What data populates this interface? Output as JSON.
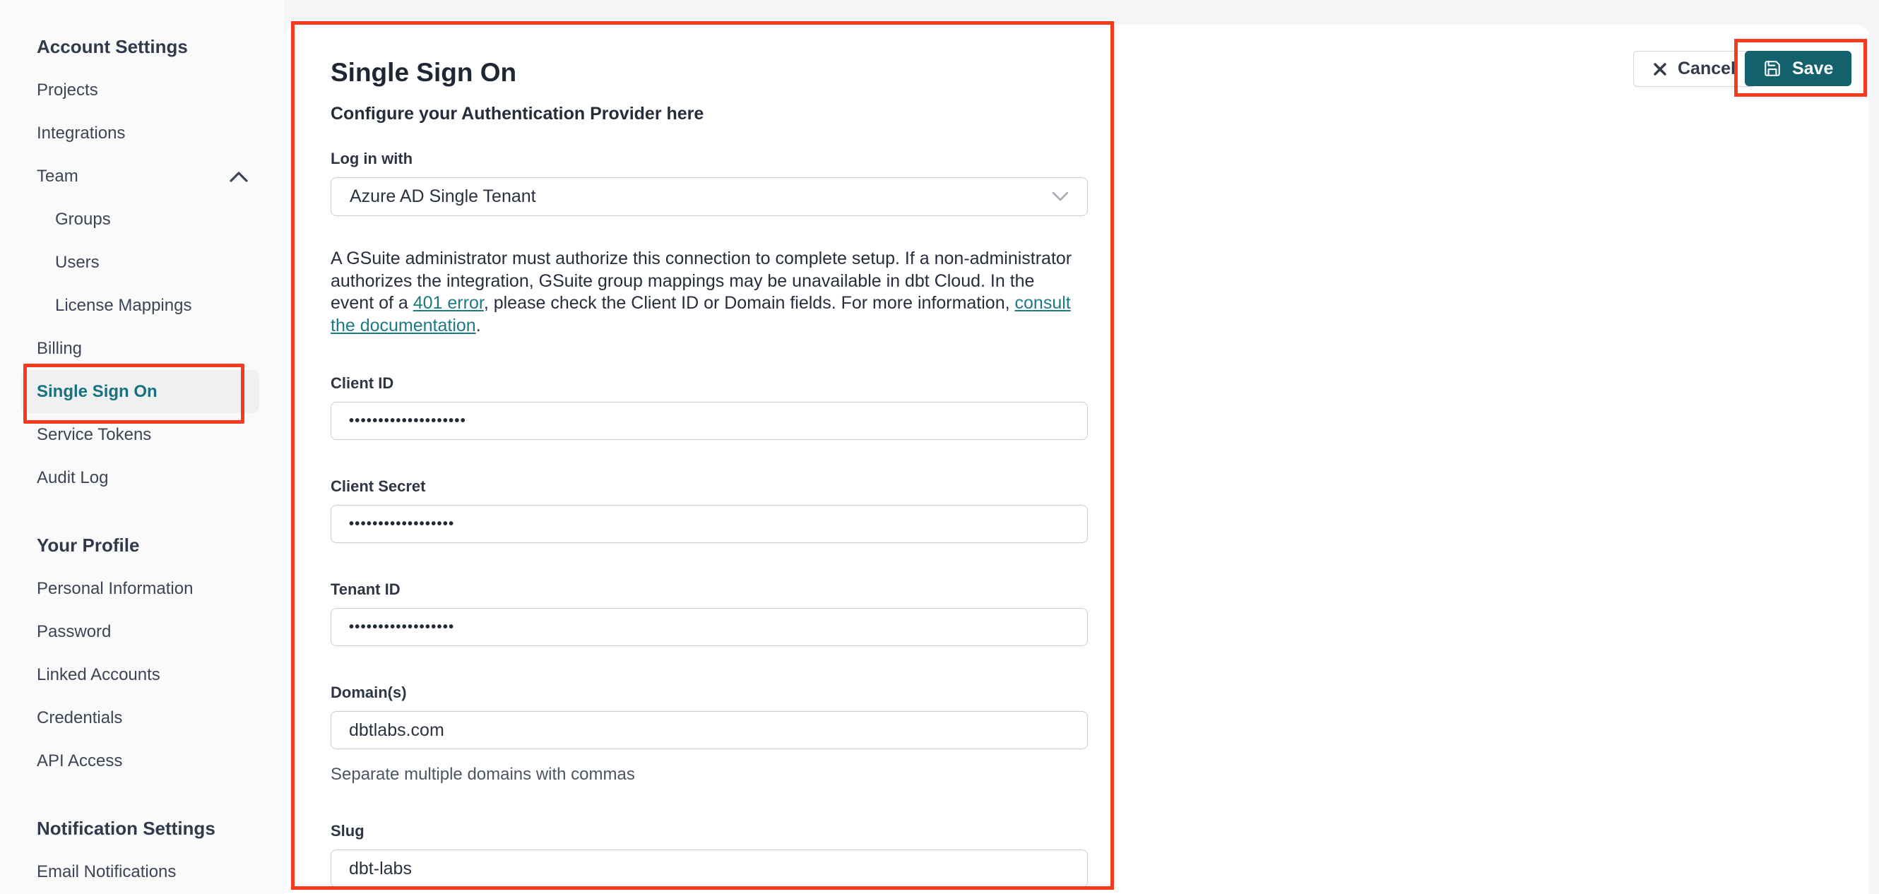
{
  "colors": {
    "accent_teal": "#18717f",
    "link_teal": "#1e7987",
    "save_button_bg": "#12616d",
    "annotation_red": "#f53b1e"
  },
  "sidebar": {
    "items": [
      {
        "label": "Account Settings"
      },
      {
        "label": "Projects"
      },
      {
        "label": "Integrations"
      },
      {
        "label": "Team"
      },
      {
        "label": "Groups"
      },
      {
        "label": "Users"
      },
      {
        "label": "License Mappings"
      },
      {
        "label": "Billing"
      },
      {
        "label": "Single Sign On"
      },
      {
        "label": "Service Tokens"
      },
      {
        "label": "Audit Log"
      },
      {
        "label": "Your Profile"
      },
      {
        "label": "Personal Information"
      },
      {
        "label": "Password"
      },
      {
        "label": "Linked Accounts"
      },
      {
        "label": "Credentials"
      },
      {
        "label": "API Access"
      },
      {
        "label": "Notification Settings"
      },
      {
        "label": "Email Notifications"
      }
    ]
  },
  "header_actions": {
    "cancel_label": "Cancel",
    "save_label": "Save"
  },
  "page": {
    "title": "Single Sign On",
    "subtitle": "Configure your Authentication Provider here"
  },
  "form": {
    "login_with": {
      "label": "Log in with",
      "value": "Azure AD Single Tenant"
    },
    "description": {
      "part1": "A GSuite administrator must authorize this connection to complete setup. If a non-administrator authorizes the integration, GSuite group mappings may be unavailable in dbt Cloud. In the event of a ",
      "link1": "401 error",
      "part2": ", please check the Client ID or Domain fields. For more information, ",
      "link2": "consult the documentation",
      "part3": "."
    },
    "client_id": {
      "label": "Client ID",
      "value": "••••••••••••••••••••"
    },
    "client_secret": {
      "label": "Client Secret",
      "value": "••••••••••••••••••"
    },
    "tenant_id": {
      "label": "Tenant ID",
      "value": "••••••••••••••••••"
    },
    "domains": {
      "label": "Domain(s)",
      "value": "dbtlabs.com",
      "helper": "Separate multiple domains with commas"
    },
    "slug": {
      "label": "Slug",
      "value": "dbt-labs"
    }
  }
}
